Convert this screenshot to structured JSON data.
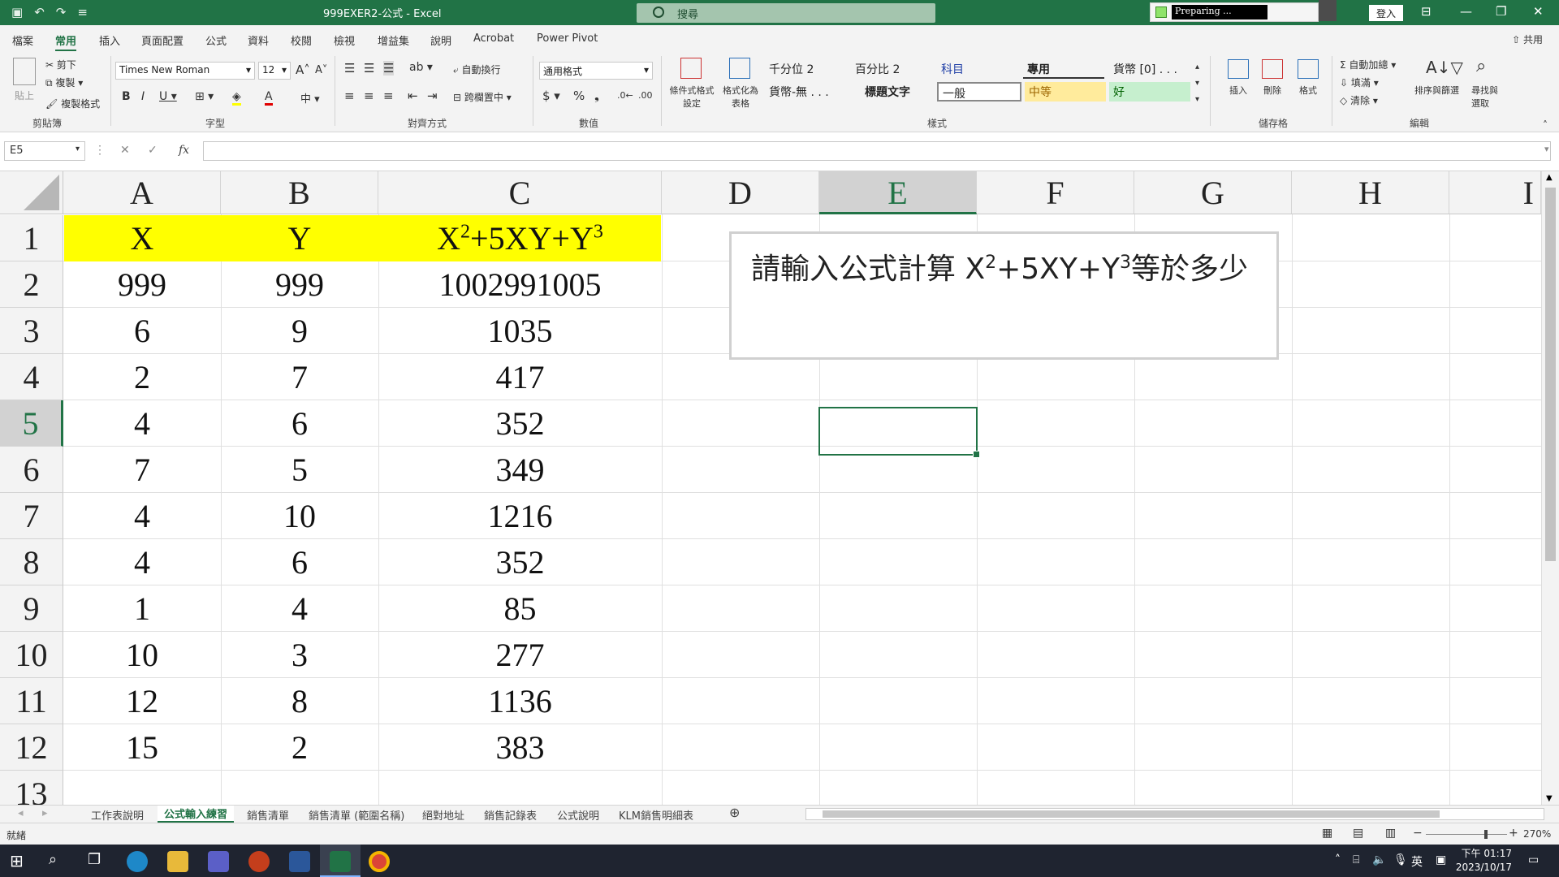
{
  "window": {
    "title": "999EXER2-公式 - Excel",
    "search_placeholder": "搜尋",
    "preparing": "Preparing ...",
    "login": "登入"
  },
  "ribbon_tabs": [
    "檔案",
    "常用",
    "插入",
    "頁面配置",
    "公式",
    "資料",
    "校閱",
    "檢視",
    "增益集",
    "說明",
    "Acrobat",
    "Power Pivot"
  ],
  "share": "共用",
  "clipboard": {
    "cut": "剪下",
    "copy": "複製",
    "format_painter": "複製格式",
    "paste": "貼上",
    "label": "剪貼簿"
  },
  "font": {
    "name": "Times New Roman",
    "size": "12",
    "label": "字型"
  },
  "alignment": {
    "wrap": "自動換行",
    "merge": "跨欄置中",
    "label": "對齊方式"
  },
  "number": {
    "format": "通用格式",
    "label": "數值"
  },
  "styles": {
    "cond_format": "條件式格式設定",
    "format_table": "格式化為表格",
    "cells": [
      "千分位 2",
      "百分比 2",
      "科目",
      "專用",
      "貨幣 [0] . . .",
      "貨幣-無 . . .",
      "標題文字",
      "一般",
      "中等",
      "好"
    ],
    "label": "樣式"
  },
  "cells_group": {
    "insert": "插入",
    "delete": "刪除",
    "format": "格式",
    "label": "儲存格"
  },
  "editing": {
    "autosum": "自動加總",
    "fill": "填滿",
    "clear": "清除",
    "sort": "排序與篩選",
    "find": "尋找與選取",
    "label": "編輯"
  },
  "namebox": "E5",
  "columns": [
    "A",
    "B",
    "C",
    "D",
    "E",
    "F",
    "G",
    "H",
    "I"
  ],
  "rows": [
    "1",
    "2",
    "3",
    "4",
    "5",
    "6",
    "7",
    "8",
    "9",
    "10",
    "11",
    "12",
    "13"
  ],
  "header": {
    "x": "X",
    "y": "Y",
    "formula_base1": "X",
    "exp1": "2",
    "formula_mid": "+5XY+Y",
    "exp2": "3"
  },
  "table": [
    [
      "999",
      "999",
      "1002991005"
    ],
    [
      "6",
      "9",
      "1035"
    ],
    [
      "2",
      "7",
      "417"
    ],
    [
      "4",
      "6",
      "352"
    ],
    [
      "7",
      "5",
      "349"
    ],
    [
      "4",
      "10",
      "1216"
    ],
    [
      "4",
      "6",
      "352"
    ],
    [
      "1",
      "4",
      "85"
    ],
    [
      "10",
      "3",
      "277"
    ],
    [
      "12",
      "8",
      "1136"
    ],
    [
      "15",
      "2",
      "383"
    ]
  ],
  "textbox": {
    "prefix": "請輸入公式計算 X",
    "sup1": "2",
    "mid": "+5XY+Y",
    "sup2": "3",
    "suffix": "等於多少"
  },
  "sheets": [
    "工作表說明",
    "公式輸入練習",
    "銷售清單",
    "銷售清單 (範圍名稱)",
    "絕對地址",
    "銷售記錄表",
    "公式說明",
    "KLM銷售明細表"
  ],
  "status": {
    "ready": "就緒",
    "zoom": "270%"
  },
  "taskbar": {
    "time": "下午 01:17",
    "date": "2023/10/17",
    "ime": "英"
  },
  "colors": {
    "accent": "#217346",
    "header_fill": "#ffff00"
  }
}
